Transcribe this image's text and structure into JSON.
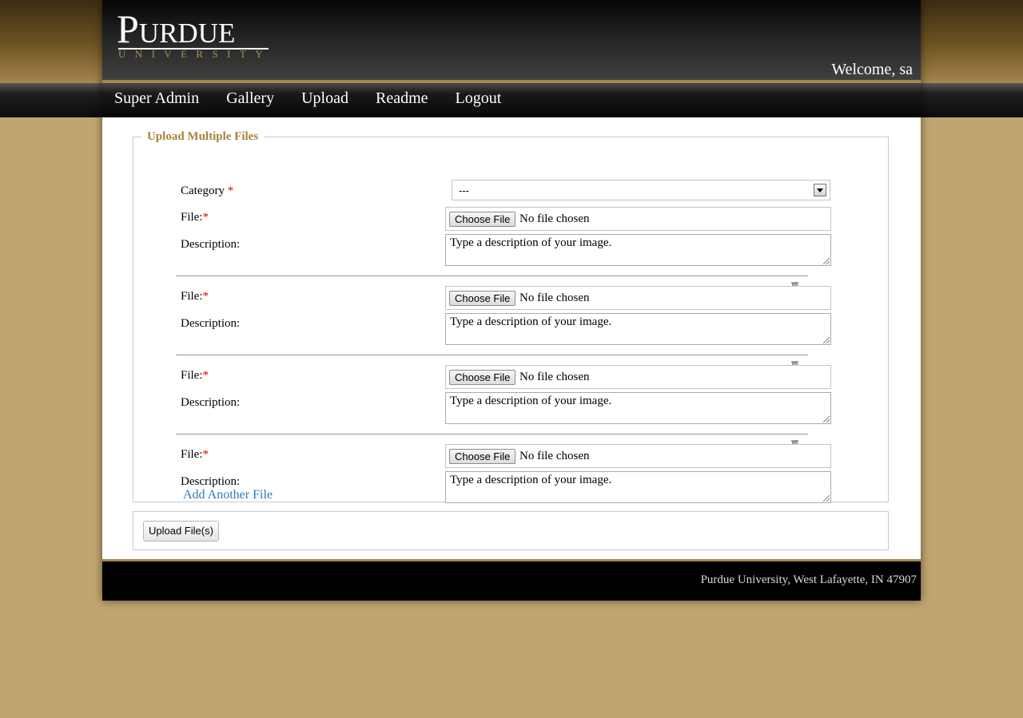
{
  "brand": {
    "name": "Purdue",
    "sub": "UNIVERSITY"
  },
  "header": {
    "welcome": "Welcome, sa"
  },
  "nav": {
    "items": [
      "Super Admin",
      "Gallery",
      "Upload",
      "Readme",
      "Logout"
    ]
  },
  "form": {
    "legend": "Upload Multiple Files",
    "category": {
      "label": "Category",
      "required": "*",
      "value": "---"
    },
    "entries": [
      {
        "file_label": "File:",
        "required": "*",
        "choose": "Choose File",
        "status": "No file chosen",
        "desc_label": "Description:",
        "desc_placeholder": "Type a description of your image."
      },
      {
        "file_label": "File:",
        "required": "*",
        "choose": "Choose File",
        "status": "No file chosen",
        "desc_label": "Description:",
        "desc_placeholder": "Type a description of your image."
      },
      {
        "file_label": "File:",
        "required": "*",
        "choose": "Choose File",
        "status": "No file chosen",
        "desc_label": "Description:",
        "desc_placeholder": "Type a description of your image."
      },
      {
        "file_label": "File:",
        "required": "*",
        "choose": "Choose File",
        "status": "No file chosen",
        "desc_label": "Description:",
        "desc_placeholder": "Type a description of your image."
      }
    ],
    "add_link": "Add Another File",
    "submit": "Upload File(s)"
  },
  "footer": {
    "text": "Purdue University, West Lafayette, IN 47907"
  },
  "colors": {
    "accent_gold": "#a8823a",
    "link_blue": "#2a7ab8",
    "required_red": "#e00000",
    "page_bg": "#c0a570"
  }
}
